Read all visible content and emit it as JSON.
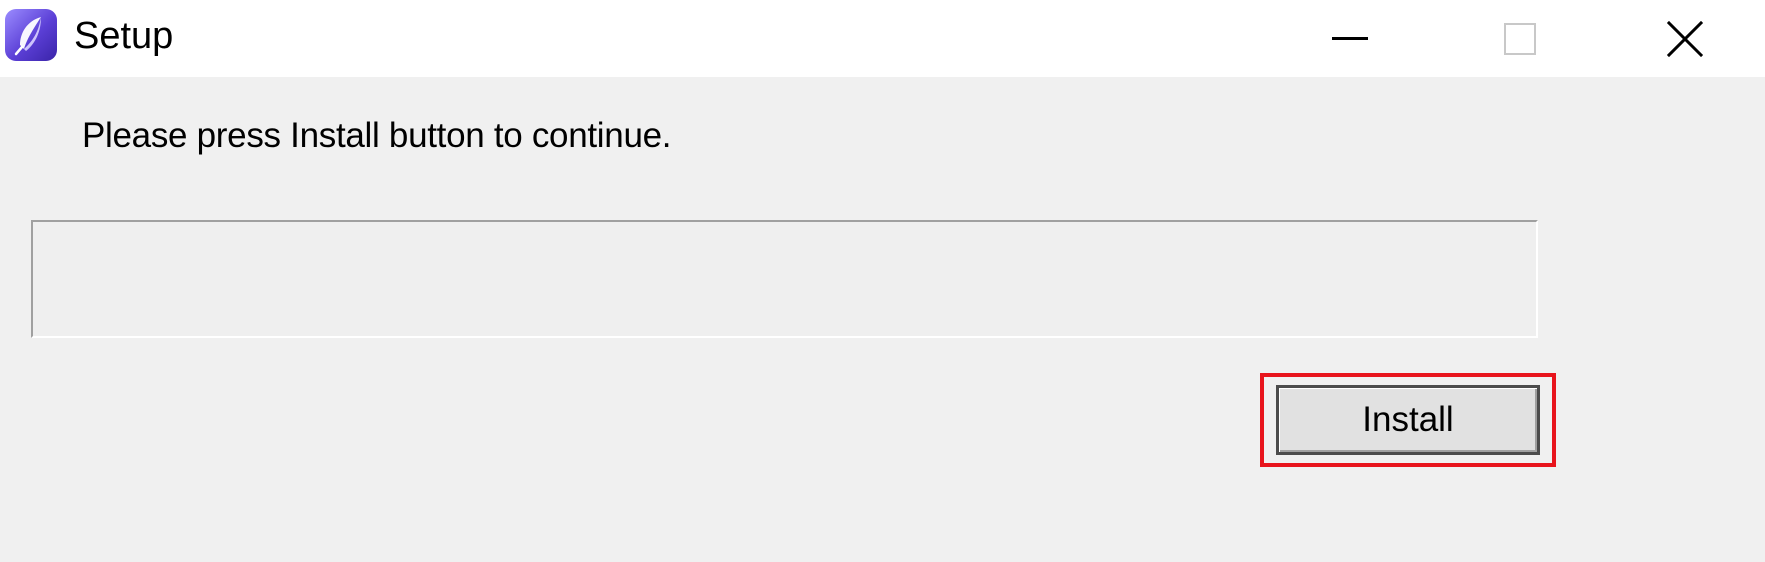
{
  "window": {
    "title": "Setup",
    "icon": "setup-feather-icon",
    "caption_buttons": [
      {
        "name": "minimize",
        "icon": "minimize-icon"
      },
      {
        "name": "maximize",
        "icon": "maximize-icon",
        "state": "disabled"
      },
      {
        "name": "close",
        "icon": "close-icon"
      }
    ]
  },
  "main": {
    "message": "Please press Install button to continue.",
    "progress": {
      "value": 0
    },
    "install_button_label": "Install"
  },
  "annotation": {
    "highlight_color": "#e8141c",
    "highlight_target": "install-button"
  },
  "colors": {
    "window_bg": "#f0f0f0",
    "titlebar_bg": "#ffffff",
    "button_bg": "#e1e1e1",
    "accent_icon": "#5b3fd6"
  }
}
